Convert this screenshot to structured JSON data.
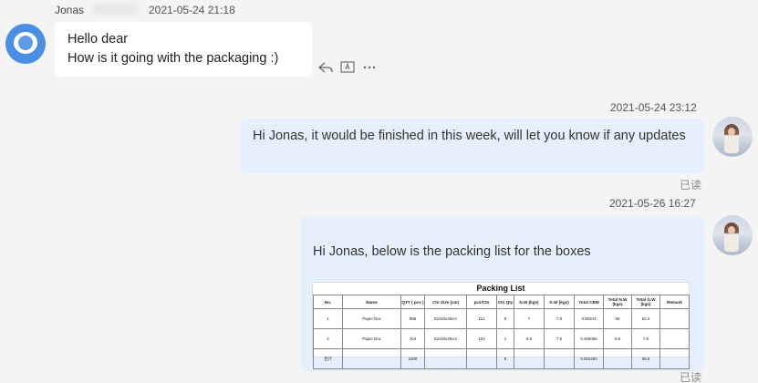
{
  "incoming": {
    "sender": "Jonas",
    "timestamp": "2021-05-24 21:18",
    "lines": [
      "Hello dear",
      "How is it going with the packaging :)"
    ],
    "actions": [
      "reply-icon",
      "translate-icon",
      "more-icon"
    ]
  },
  "outgoing1": {
    "timestamp": "2021-05-24 23:12",
    "text": "Hi Jonas, it would be finished in this week, will let you know if any updates",
    "status": "已读"
  },
  "outgoing2": {
    "timestamp": "2021-05-26 16:27",
    "text": "Hi Jonas, below is the packing list for the boxes",
    "status": "已读",
    "packing_list": {
      "title": "Packing List",
      "headers": [
        "No.",
        "Name",
        "QTY ( pcs )",
        "Ctn Size (cm)",
        "pcs/Ctn",
        "Ctn Qty",
        "N.W (kgs)",
        "G.W (kgs)",
        "Total CBM",
        "Total N.W (kgs)",
        "Total G.W (kgs)",
        "Remark"
      ],
      "rows": [
        [
          "1",
          "Paper Box",
          "896",
          "62x40x29cm",
          "112",
          "8",
          "7",
          "7.8",
          "0.50344",
          "56",
          "62.4",
          ""
        ],
        [
          "2",
          "Paper Box",
          "104",
          "62x40x29cm",
          "104",
          "1",
          "6.8",
          "7.5",
          "0.489056",
          "6.8",
          "7.5",
          ""
        ],
        [
          "合计",
          "",
          "1000",
          "",
          "",
          "9",
          "",
          "",
          "0.092400",
          "",
          "69.9",
          ""
        ]
      ]
    }
  }
}
